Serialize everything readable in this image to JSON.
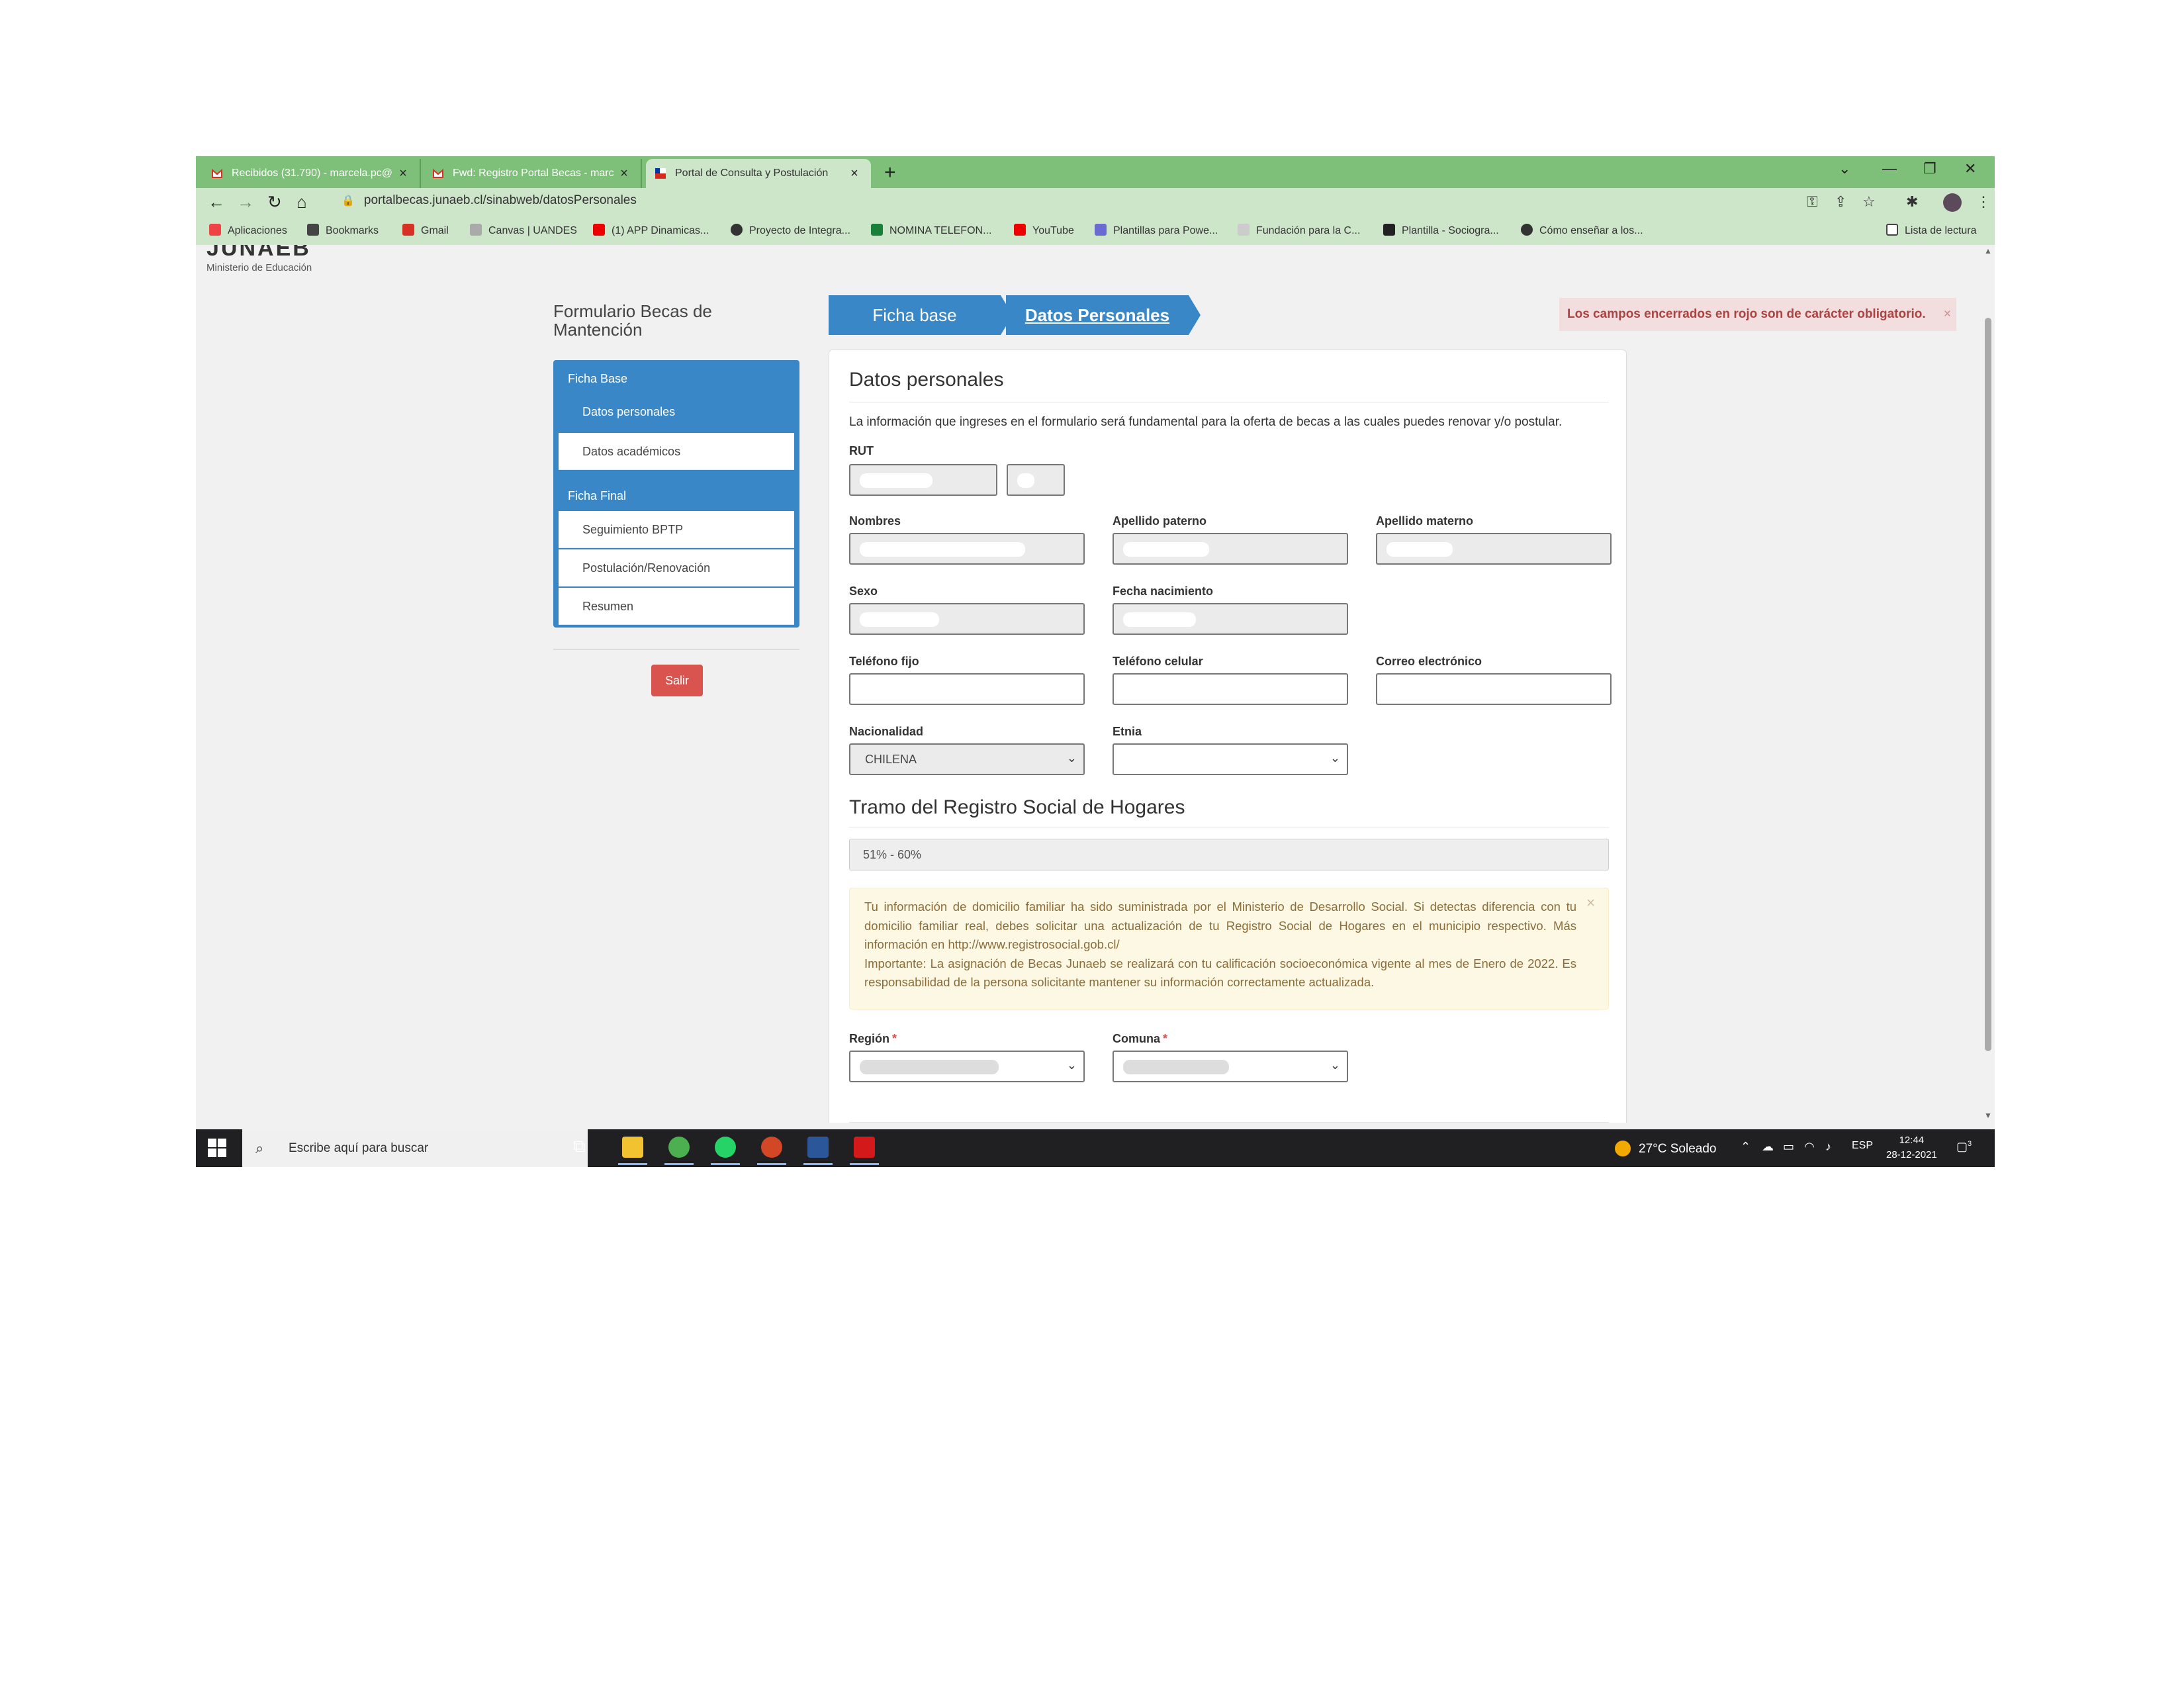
{
  "browser": {
    "tabs": [
      {
        "title": "Recibidos (31.790) - marcela.pc@",
        "active": false
      },
      {
        "title": "Fwd: Registro Portal Becas - marc",
        "active": false
      },
      {
        "title": "Portal de Consulta y Postulación",
        "active": true
      }
    ],
    "new_tab": "+",
    "window_controls": {
      "tab_search": "⌄",
      "minimize": "—",
      "restore": "❐",
      "close": "✕"
    },
    "url": "portalbecas.junaeb.cl/sinabweb/datosPersonales",
    "bookmarks": [
      {
        "label": "Aplicaciones",
        "icon": "apps-grid-icon",
        "color": "#e44"
      },
      {
        "label": "Bookmarks",
        "icon": "star-icon",
        "color": "#444"
      },
      {
        "label": "Gmail",
        "icon": "gmail-icon",
        "color": "#d93025"
      },
      {
        "label": "Canvas | UANDES",
        "icon": "canvas-icon",
        "color": "#aaa"
      },
      {
        "label": "(1) APP Dinamicas...",
        "icon": "youtube-icon",
        "color": "#e00"
      },
      {
        "label": "Proyecto de Integra...",
        "icon": "globe-icon",
        "color": "#333"
      },
      {
        "label": "NOMINA TELEFON...",
        "icon": "sheets-icon",
        "color": "#188038"
      },
      {
        "label": "YouTube",
        "icon": "youtube-icon",
        "color": "#e00"
      },
      {
        "label": "Plantillas para Powe...",
        "icon": "template-icon",
        "color": "#6a6ad0"
      },
      {
        "label": "Fundación para la C...",
        "icon": "foundation-icon",
        "color": "#ccc"
      },
      {
        "label": "Plantilla - Sociogra...",
        "icon": "doc-icon",
        "color": "#222"
      },
      {
        "label": "Cómo enseñar a los...",
        "icon": "globe-icon",
        "color": "#333"
      }
    ],
    "reading_list": "Lista de lectura"
  },
  "header": {
    "logo": "JUNAEB",
    "ministry": "Ministerio de Educación"
  },
  "sidebar": {
    "title": "Formulario Becas de Mantención",
    "section1": "Ficha Base",
    "section1_items": [
      "Datos personales",
      "Datos académicos"
    ],
    "section2": "Ficha Final",
    "section2_items": [
      "Seguimiento BPTP",
      "Postulación/Renovación",
      "Resumen"
    ],
    "logout": "Salir"
  },
  "steps": [
    "Ficha base",
    "Datos Personales"
  ],
  "alert": {
    "text": "Los campos encerrados en rojo son de carácter obligatorio.",
    "close": "×"
  },
  "form": {
    "heading": "Datos personales",
    "intro": "La información que ingreses en el formulario será fundamental para la oferta de becas a las cuales puedes renovar y/o postular.",
    "labels": {
      "rut": "RUT",
      "nombres": "Nombres",
      "apellido_paterno": "Apellido paterno",
      "apellido_materno": "Apellido materno",
      "sexo": "Sexo",
      "fecha_nacimiento": "Fecha nacimiento",
      "telefono_fijo": "Teléfono fijo",
      "telefono_celular": "Teléfono celular",
      "correo": "Correo electrónico",
      "nacionalidad": "Nacionalidad",
      "etnia": "Etnia",
      "region": "Región",
      "comuna": "Comuna"
    },
    "required_mark": "*",
    "nacionalidad_value": "CHILENA",
    "rsh_heading": "Tramo del Registro Social de Hogares",
    "rsh_value": "51% - 60%",
    "info_lines": [
      "Tu información de domicilio familiar ha sido suministrada por el Ministerio de Desarrollo Social. Si detectas diferencia con tu domicilio familiar real, debes solicitar una actualización de tu Registro Social de Hogares en el municipio respectivo. Más información en http://www.registrosocial.gob.cl/",
      "Importante: La asignación de Becas Junaeb se realizará con tu calificación socioeconómica vigente al mes de Enero de 2022. Es responsabilidad de la persona solicitante mantener su información correctamente actualizada."
    ],
    "info_close": "×"
  },
  "taskbar": {
    "search_placeholder": "Escribe aquí para buscar",
    "weather": "27°C  Soleado",
    "language": "ESP",
    "time": "12:44",
    "date": "28-12-2021",
    "notifications": "3"
  }
}
